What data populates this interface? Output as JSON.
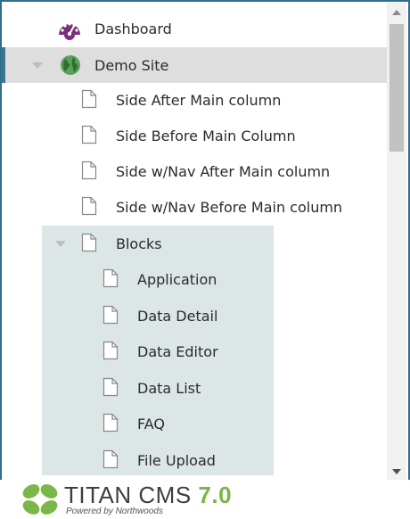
{
  "tree": {
    "dashboard": {
      "label": "Dashboard"
    },
    "demo_site": {
      "label": "Demo Site"
    },
    "pages": [
      {
        "label": "Side After Main column"
      },
      {
        "label": "Side Before Main Column"
      },
      {
        "label": "Side w/Nav After Main column"
      },
      {
        "label": "Side w/Nav Before Main column"
      }
    ],
    "blocks": {
      "label": "Blocks",
      "children": [
        {
          "label": "Application"
        },
        {
          "label": "Data Detail"
        },
        {
          "label": "Data Editor"
        },
        {
          "label": "Data List"
        },
        {
          "label": "FAQ"
        },
        {
          "label": "File Upload"
        }
      ]
    }
  },
  "footer": {
    "brand": "TITAN CMS",
    "version": "7.0",
    "tagline": "Powered by Northwoods"
  },
  "colors": {
    "accent": "#3a7891",
    "selected_bg": "#dedede",
    "blocks_bg": "#dde6e6",
    "globe": "#5aa05a",
    "dashboard_icon": "#7b2f7b",
    "logo_green": "#7ab648"
  }
}
